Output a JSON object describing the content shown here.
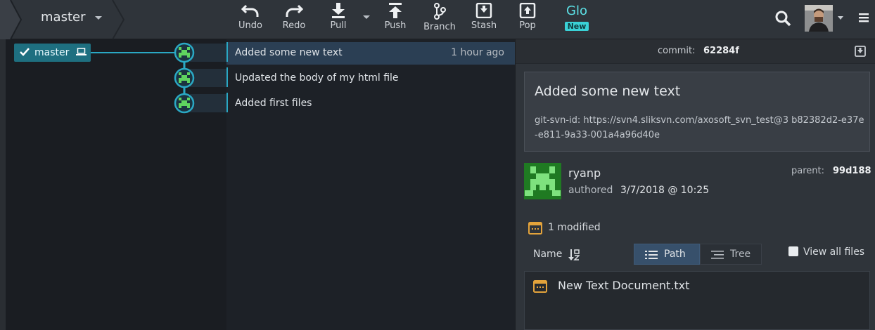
{
  "toolbar": {
    "branch": "master",
    "buttons": [
      {
        "id": "undo",
        "label": "Undo"
      },
      {
        "id": "redo",
        "label": "Redo"
      },
      {
        "id": "pull",
        "label": "Pull"
      },
      {
        "id": "push",
        "label": "Push"
      },
      {
        "id": "branch",
        "label": "Branch"
      },
      {
        "id": "stash",
        "label": "Stash"
      },
      {
        "id": "pop",
        "label": "Pop"
      }
    ],
    "glo": {
      "title": "Glo",
      "badge": "New"
    },
    "icons": [
      "search-icon",
      "avatar",
      "hamburger-menu-icon"
    ]
  },
  "graph": {
    "branch_tag": {
      "name": "master",
      "icons": [
        "check-icon",
        "laptop-icon"
      ]
    },
    "node_color": "#2aa8c4",
    "commits": [
      {
        "message": "Added some new text",
        "time": "1 hour ago",
        "selected": true
      },
      {
        "message": "Updated the body of my html file",
        "time": "",
        "selected": false
      },
      {
        "message": "Added first files",
        "time": "",
        "selected": false
      }
    ]
  },
  "detail": {
    "commit_label": "commit:",
    "commit_sha": "62284f",
    "summary": "Added some new text",
    "body": "git-svn-id: https://svn4.sliksvn.com/axosoft_svn_test@3 b82382d2-e37e-e811-9a33-001a4a96d40e",
    "author": "ryanp",
    "authored_label": "authored",
    "authored_date": "3/7/2018 @ 10:25",
    "parent_label": "parent:",
    "parent_sha": "99d188",
    "modified": "1 modified",
    "sort_label": "Name",
    "view_path": "Path",
    "view_tree": "Tree",
    "view_all_files": "View all files",
    "files": [
      {
        "name": "New Text Document.txt",
        "status": "modified",
        "status_color": "#e3a33b"
      }
    ]
  }
}
